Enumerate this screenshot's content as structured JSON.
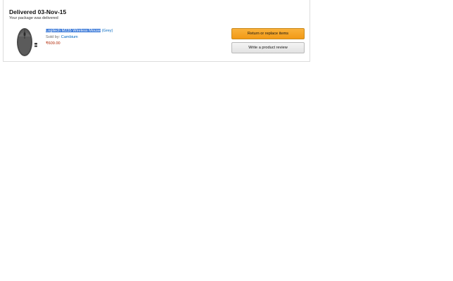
{
  "order": {
    "delivery_title": "Delivered 03-Nov-15",
    "delivery_subtitle": "Your package was delivered",
    "item": {
      "name": "Logitech M235 Wireless Mouse",
      "variant": "(Grey)",
      "sold_by_label": "Sold by:",
      "seller": "Cambium",
      "price": "₹609.00"
    },
    "actions": {
      "return_label": "Return or replace items",
      "review_label": "Write a product review"
    }
  },
  "colors": {
    "accent_button": "#f29a16",
    "link": "#0066c0",
    "price": "#b12704",
    "selection": "#3d7bd9"
  },
  "icons": {
    "product_image": "wireless-mouse-image"
  }
}
